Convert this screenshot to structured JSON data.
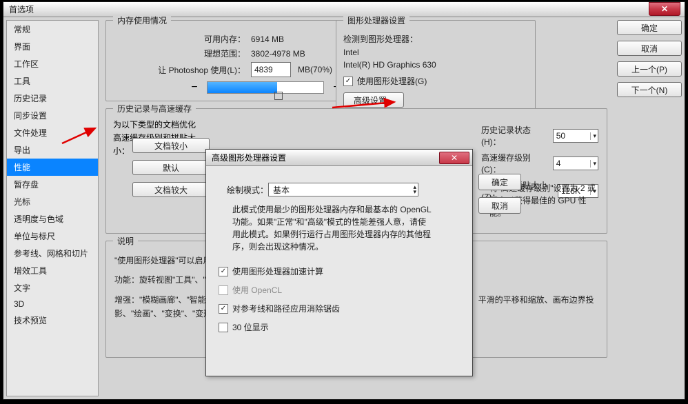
{
  "window": {
    "title": "首选项"
  },
  "buttons": {
    "ok": "确定",
    "cancel": "取消",
    "prev": "上一个(P)",
    "next": "下一个(N)"
  },
  "sidebar": {
    "items": [
      "常规",
      "界面",
      "工作区",
      "工具",
      "历史记录",
      "同步设置",
      "文件处理",
      "导出",
      "性能",
      "暂存盘",
      "光标",
      "透明度与色域",
      "单位与标尺",
      "参考线、网格和切片",
      "增效工具",
      "文字",
      "3D",
      "技术预览"
    ],
    "selected_index": 8
  },
  "memory": {
    "group_title": "内存使用情况",
    "available_label": "可用内存：",
    "available_value": "6914 MB",
    "ideal_label": "理想范围：",
    "ideal_value": "3802-4978 MB",
    "let_label": "让 Photoshop 使用(L)：",
    "let_value": "4839",
    "let_suffix": "MB(70%)",
    "minus": "−",
    "plus": "+"
  },
  "gpu": {
    "group_title": "图形处理器设置",
    "detected_label": "检测到图形处理器：",
    "vendor": "Intel",
    "model": "Intel(R) HD Graphics 630",
    "use_gpu": "使用图形处理器(G)",
    "advanced": "高级设置..."
  },
  "history": {
    "group_title": "历史记录与高速缓存",
    "hint1": "为以下类型的文档优化高速缓存级别和拼贴大小：",
    "doc_small": "文档较小",
    "doc_default": "默认",
    "doc_large": "文档较大",
    "states_label": "历史记录状态(H)：",
    "states_value": "50",
    "cache_label": "高速缓存级别(C)：",
    "cache_value": "4",
    "tile_label": "高速缓存拼贴大小(Z)：",
    "tile_value": "128K",
    "note": "将\"高速缓存级别\"设置为 2 或更高以获得最佳的 GPU 性能。"
  },
  "desc": {
    "group_title": "说明",
    "line1": "\"使用图形处理器\"可以启用或禁用整体的图形处理器使用。",
    "line2a": "功能：旋转视图\"工具\"、\"鸟瞰缩放\"、\"像素网格\"、\"轻击平移\"、\"细微缩放\"、画布画笔大小调整等。",
    "line3a": "增强：\"模糊画廊\"、\"智能锐化\"、\"选择并遮住\"、\"液化\"、\"油画\"、\"光照效果\"、图片包、\"操控变形\"、平滑的平移和缩放、画布边界投影、\"绘画\"、\"变换\"、\"变形\"、\"操控变形\"、平滑的平移"
  },
  "modal": {
    "title": "高级图形处理器设置",
    "ok": "确定",
    "cancel": "取消",
    "mode_label": "绘制模式：",
    "mode_value": "基本",
    "desc": "此模式使用最少的图形处理器内存和最基本的 OpenGL 功能。如果\"正常\"和\"高级\"模式的性能差强人意，请使用此模式。如果例行运行占用图形处理器内存的其他程序，则会出现这种情况。",
    "cb1": "使用图形处理器加速计算",
    "cb2": "使用 OpenCL",
    "cb3": "对参考线和路径应用消除锯齿",
    "cb4": "30 位显示"
  }
}
